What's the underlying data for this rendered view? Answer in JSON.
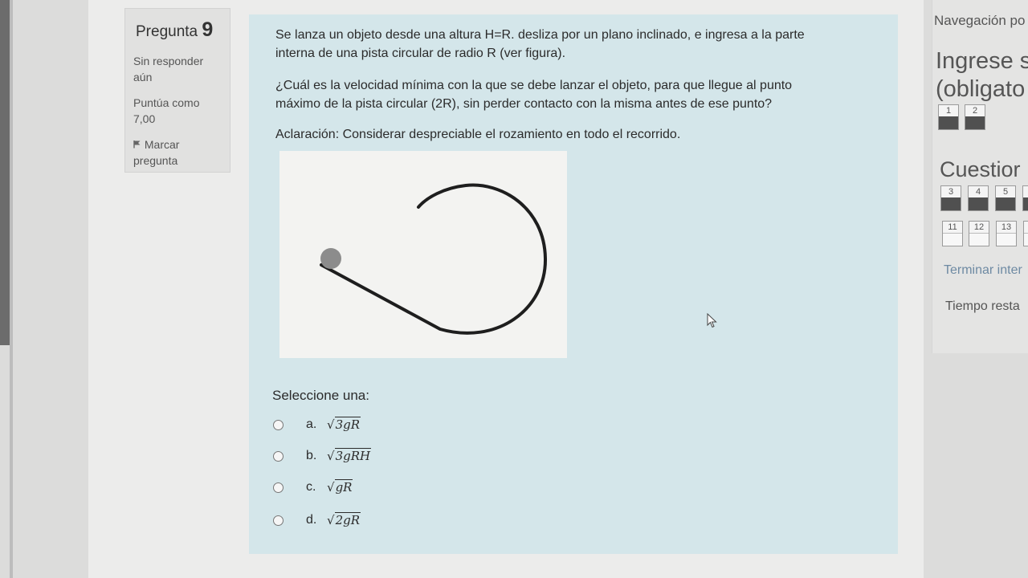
{
  "question_info": {
    "title": "Pregunta",
    "number": "9",
    "status": "Sin responder aún",
    "grade_label": "Puntúa como 7,00",
    "flag_label": "Marcar pregunta"
  },
  "question": {
    "paragraph1_line1": "Se lanza un objeto desde una altura H=R. desliza por un plano inclinado, e ingresa a la parte",
    "paragraph1_line2": "interna de una pista circular de radio R (ver figura).",
    "paragraph2_line1": "¿Cuál es la velocidad mínima con la que se debe lanzar el objeto, para que llegue al punto",
    "paragraph2_line2": "máximo de la pista circular (2R), sin perder contacto con la misma antes de ese punto?",
    "note": "Aclaración: Considerar despreciable el rozamiento en todo el recorrido.",
    "prompt": "Seleccione una:"
  },
  "answers": [
    {
      "letter": "a.",
      "radicand": "3gR"
    },
    {
      "letter": "b.",
      "radicand": "3gRH"
    },
    {
      "letter": "c.",
      "radicand": "gR"
    },
    {
      "letter": "d.",
      "radicand": "2gR"
    }
  ],
  "nav": {
    "title": "Navegación po",
    "section1_line1": "Ingrese s",
    "section1_line2": "(obligato",
    "section1_buttons": [
      "1",
      "2"
    ],
    "section2_title": "Cuestior",
    "section2_row1": [
      "3",
      "4",
      "5"
    ],
    "section2_row2": [
      "11",
      "12",
      "13"
    ],
    "finish_link": "Terminar inter",
    "time_label": "Tiempo resta"
  },
  "colors": {
    "formulation_bg": "#d4e6ea",
    "info_bg": "#e1e1e0",
    "link": "#6e8aa3",
    "answered_block": "#505050"
  }
}
